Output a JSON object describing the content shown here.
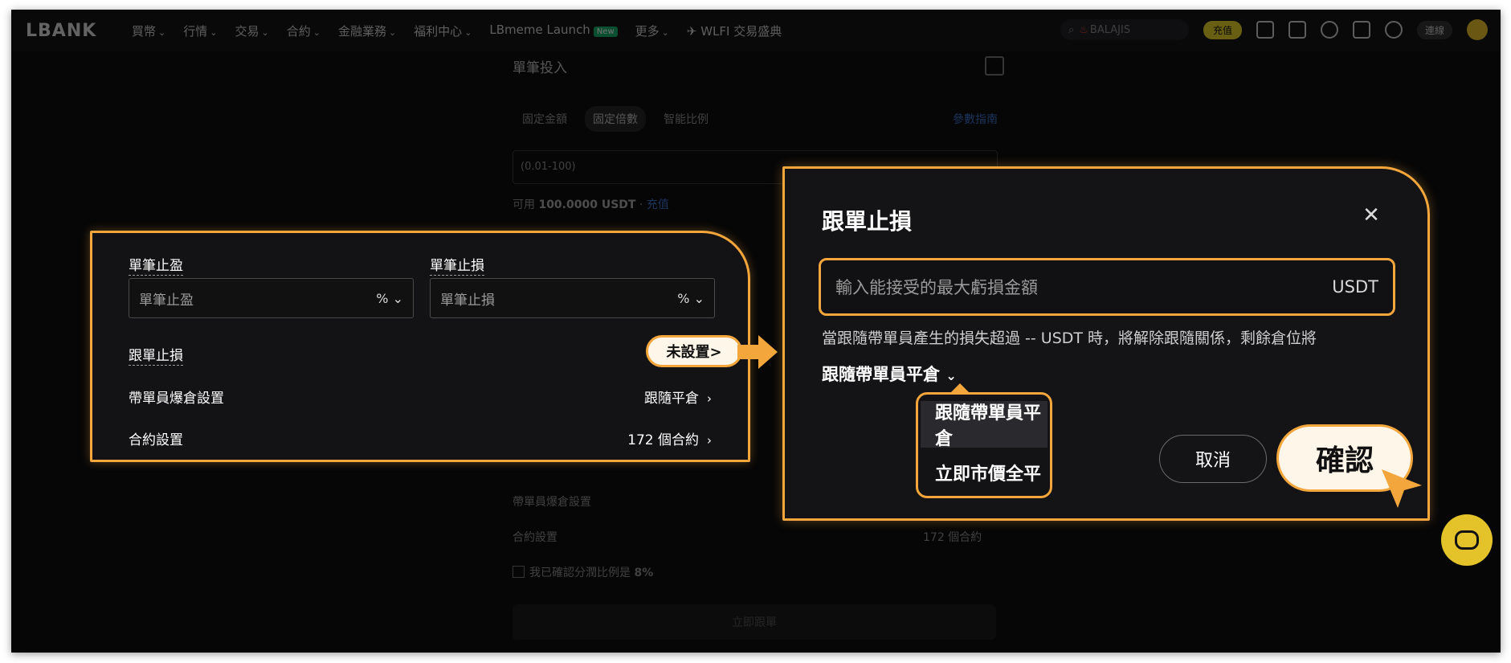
{
  "nav": {
    "logo": "LBANK",
    "items": [
      {
        "label": "買幣",
        "chev": true
      },
      {
        "label": "行情",
        "chev": true
      },
      {
        "label": "交易",
        "chev": true
      },
      {
        "label": "合約",
        "chev": true
      },
      {
        "label": "金融業務",
        "chev": true
      },
      {
        "label": "福利中心",
        "chev": true
      },
      {
        "label": "LBmeme Launch",
        "badge": "New"
      },
      {
        "label": "更多",
        "chev": true
      },
      {
        "label": "WLFI 交易盛典"
      }
    ],
    "search_text": "BALAJIS",
    "deposit_label": "充值",
    "connect_label": "連線"
  },
  "background": {
    "section_title": "單筆投入",
    "tabs": [
      "固定金額",
      "固定倍數",
      "智能比例"
    ],
    "tab_active": "固定倍數",
    "params_link": "參數指南",
    "input_placeholder": "(0.01-100)",
    "available_prefix": "可用",
    "available_value": "100.0000 USDT",
    "recharge_link": "充值",
    "liq_label": "帶單員爆倉設置",
    "contract_label": "合約設置",
    "contract_value": "172 個合約",
    "confirm_checkbox_label": "我已確認分潤比例是",
    "confirm_checkbox_value": "8%",
    "submit_label": "立即跟單"
  },
  "panel_left": {
    "tp_label": "單筆止盈",
    "tp_placeholder": "單筆止盈",
    "sl_label": "單筆止損",
    "sl_placeholder": "單筆止損",
    "unit_suffix": "%",
    "copy_sl_label": "跟單止損",
    "copy_sl_value": "未設置>",
    "liq_label": "帶單員爆倉設置",
    "liq_value": "跟隨平倉",
    "contract_label": "合約設置",
    "contract_value": "172 個合約",
    "arrow": "›"
  },
  "modal": {
    "title": "跟單止損",
    "input_placeholder": "輸入能接受的最大虧損金額",
    "input_unit": "USDT",
    "help_text": "當跟隨帶單員產生的損失超過 -- USDT 時，將解除跟隨關係，剩餘倉位將",
    "dropdown_selected": "跟隨帶單員平倉",
    "dropdown_options": [
      "跟隨帶單員平倉",
      "立即市價全平"
    ],
    "cancel_label": "取消",
    "confirm_label": "確認"
  },
  "colors": {
    "accent_orange": "#f3a63b",
    "brand_yellow": "#e4c32a"
  }
}
